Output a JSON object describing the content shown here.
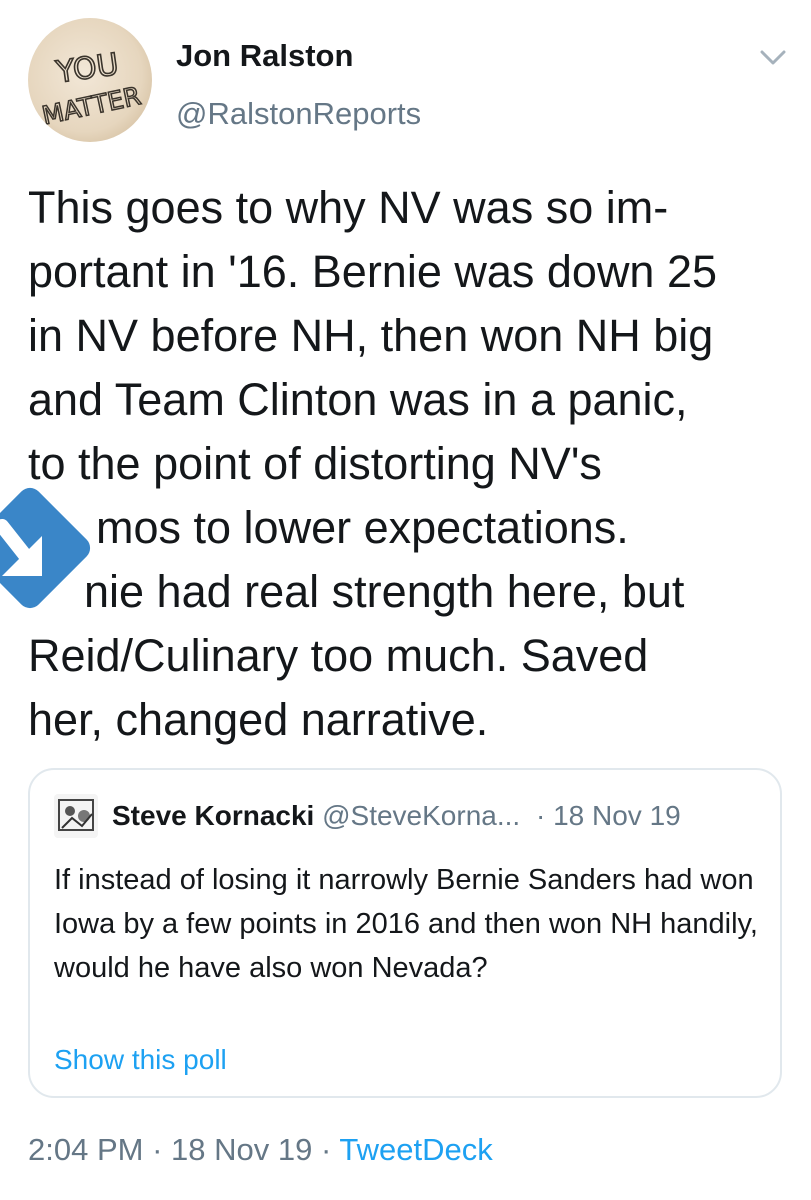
{
  "author": {
    "name": "Jon Ralston",
    "handle": "@RalstonReports",
    "avatar_text": [
      "YOU",
      "MATTER"
    ]
  },
  "tweet": {
    "lines": [
      "This goes to why NV was so im-",
      "portant in '16. Bernie was down 25",
      "in NV before NH, then won NH big",
      "and Team Clinton was in a panic,",
      "to the point of distorting NV's",
      "mos to lower expectations.",
      "nie had real strength here, but",
      "Reid/Culinary too much. Saved",
      "her, changed narrative."
    ]
  },
  "quoted": {
    "name": "Steve Kornacki",
    "handle": "@SteveKorna...",
    "separator": "·",
    "date": "18 Nov 19",
    "text": "If instead of losing it narrowly Bernie Sanders had won Iowa by a few points in 2016 and then won NH handily, would he have also won Nevada?",
    "poll_link": "Show this poll"
  },
  "footer": {
    "time": "2:04 PM",
    "sep1": "·",
    "date": "18 Nov 19",
    "sep2": "·",
    "source": "TweetDeck"
  },
  "icons": {
    "menu": "chevron-down-icon",
    "overlay": "download-arrow-icon"
  },
  "colors": {
    "link": "#1da1f2",
    "secondary_text": "#657786",
    "border": "#e1e8ed",
    "overlay_arrow": "#3a86c8"
  }
}
